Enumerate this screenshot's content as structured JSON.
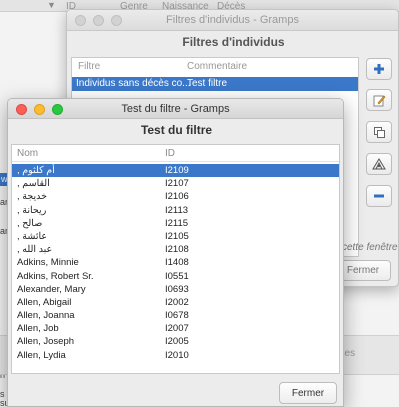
{
  "background": {
    "columns": [
      "ID",
      "Genre",
      "Naissance",
      "Décès"
    ],
    "selected_row_text": "ww",
    "left_texts": [
      "ar",
      "ar",
      "ze",
      "n",
      "s",
      "su"
    ],
    "bottom_text": "nces"
  },
  "filters_window": {
    "title": "Filtres d'individus - Gramps",
    "heading": "Filtres d'individus",
    "columns": {
      "filter": "Filtre",
      "comment": "Commentaire"
    },
    "rows": [
      {
        "filter": "Individus sans décès co...",
        "comment": "Test filtre"
      }
    ],
    "side_buttons": [
      "add-icon",
      "edit-icon",
      "copy-icon",
      "test-icon",
      "remove-icon"
    ],
    "close_hint": "cette fenêtre",
    "close_label": "Fermer"
  },
  "test_window": {
    "title": "Test du filtre - Gramps",
    "heading": "Test du filtre",
    "columns": {
      "name": "Nom",
      "id": "ID"
    },
    "rows": [
      {
        "name": ", أم كلثوم",
        "id": "I2109"
      },
      {
        "name": ", القاسم",
        "id": "I2107"
      },
      {
        "name": ", خديجة",
        "id": "I2106"
      },
      {
        "name": ", ريحانة",
        "id": "I2113"
      },
      {
        "name": ", صالح",
        "id": "I2115"
      },
      {
        "name": ", عائشة",
        "id": "I2105"
      },
      {
        "name": ", عبد الله",
        "id": "I2108"
      },
      {
        "name": "Adkins, Minnie",
        "id": "I1408"
      },
      {
        "name": "Adkins, Robert Sr.",
        "id": "I0551"
      },
      {
        "name": "Alexander, Mary",
        "id": "I0693"
      },
      {
        "name": "Allen, Abigail",
        "id": "I2002"
      },
      {
        "name": "Allen, Joanna",
        "id": "I0678"
      },
      {
        "name": "Allen, Job",
        "id": "I2007"
      },
      {
        "name": "Allen, Joseph",
        "id": "I2005"
      },
      {
        "name": "Allen, Lydia",
        "id": "I2010"
      }
    ],
    "selected_index": 0,
    "close_label": "Fermer"
  },
  "colors": {
    "selection": "#3b78c9"
  }
}
